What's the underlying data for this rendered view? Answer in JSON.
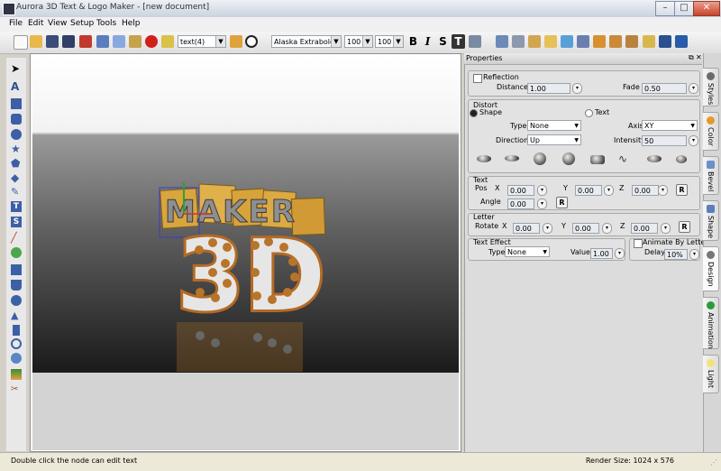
{
  "window": {
    "title": "Aurora 3D Text & Logo Maker - [new document]"
  },
  "menu": [
    "File",
    "Edit",
    "View",
    "Setup",
    "Tools",
    "Help"
  ],
  "toolbar": {
    "node_combo": "text(4)",
    "font_combo": "Alaska Extrabold",
    "size1": "100",
    "size2": "100",
    "bold": "B",
    "italic": "I",
    "strike": "S",
    "text_format": "T"
  },
  "canvas": {
    "line1": "MAKER",
    "line2": "3D"
  },
  "properties": {
    "title": "Properties",
    "reflection": {
      "label": "Reflection",
      "distance_label": "Distance",
      "distance": "1.00",
      "fade_label": "Fade",
      "fade": "0.50"
    },
    "distort": {
      "label": "Distort",
      "shape_label": "Shape",
      "text_label": "Text",
      "type_label": "Type",
      "type_value": "None",
      "axis_label": "Axis",
      "axis_value": "XY",
      "direction_label": "Direction",
      "direction_value": "Up",
      "intensity_label": "Intensity",
      "intensity_value": "50"
    },
    "text": {
      "label": "Text",
      "pos_label": "Pos",
      "x_label": "X",
      "y_label": "Y",
      "z_label": "Z",
      "x": "0.00",
      "y": "0.00",
      "z": "0.00",
      "angle_label": "Angle",
      "angle": "0.00",
      "reset": "R"
    },
    "letter": {
      "label": "Letter",
      "rotate_label": "Rotate",
      "x_label": "X",
      "y_label": "Y",
      "z_label": "Z",
      "x": "0.00",
      "y": "0.00",
      "z": "0.00",
      "reset": "R"
    },
    "text_effect": {
      "label": "Text Effect",
      "type_label": "Type",
      "type_value": "None",
      "value_label": "Value",
      "value": "1.00"
    },
    "animate": {
      "label": "Animate By Letter",
      "delay_label": "Delay",
      "delay": "10%"
    }
  },
  "tabs": [
    "Styles",
    "Color",
    "Bevel",
    "Shape",
    "Design",
    "Animation",
    "Light"
  ],
  "status": {
    "hint": "Double click the node can edit text",
    "render_size": "Render Size: 1024 x 576"
  }
}
